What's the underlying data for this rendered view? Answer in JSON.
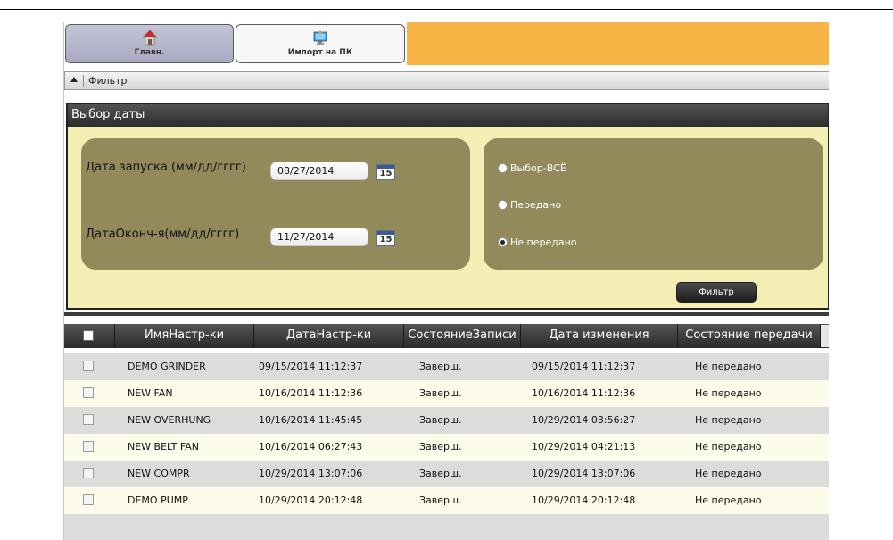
{
  "tabs": {
    "home": "Главн.",
    "import": "Импорт на ПК"
  },
  "filter": {
    "header": "Фильтр",
    "panel_title": "Выбор даты",
    "start_label": "Дата запуска (мм/дд/гггг)",
    "start_value": "08/27/2014",
    "end_label": "ДатаОконч-я(мм/дд/гггг)",
    "end_value": "11/27/2014",
    "calendar_day": "15",
    "radios": [
      "Выбор-ВСЁ",
      "Передано",
      "Не передано"
    ],
    "selected_radio": "Не передано",
    "button": "Фильтр"
  },
  "table": {
    "headers": [
      "ИмяНастр-ки",
      "ДатаНастр-ки",
      "СостояниеЗаписи",
      "Дата изменения",
      "Состояние передачи"
    ],
    "rows": [
      [
        "DEMO GRINDER",
        "09/15/2014 11:12:37",
        "Заверш.",
        "09/15/2014 11:12:37",
        "Не передано"
      ],
      [
        "NEW FAN",
        "10/16/2014 11:12:36",
        "Заверш.",
        "10/16/2014 11:12:36",
        "Не передано"
      ],
      [
        "NEW OVERHUNG",
        "10/16/2014 11:45:45",
        "Заверш.",
        "10/29/2014 03:56:27",
        "Не передано"
      ],
      [
        "NEW BELT FAN",
        "10/16/2014 06:27:43",
        "Заверш.",
        "10/29/2014 04:21:13",
        "Не передано"
      ],
      [
        "NEW COMPR",
        "10/29/2014 13:07:06",
        "Заверш.",
        "10/29/2014 13:07:06",
        "Не передано"
      ],
      [
        "DEMO PUMP",
        "10/29/2014 20:12:48",
        "Заверш.",
        "10/29/2014 20:12:48",
        "Не передано"
      ]
    ]
  },
  "colors": {
    "tabbar_accent": "#f6b544",
    "panel_background": "#f3efb4",
    "group_box": "#938a5c",
    "header_dark": "#2c2c2c"
  },
  "icons": {
    "home": "home-icon",
    "import": "monitor-import-icon",
    "calendar": "calendar-icon",
    "collapse": "triangle-up-icon"
  }
}
